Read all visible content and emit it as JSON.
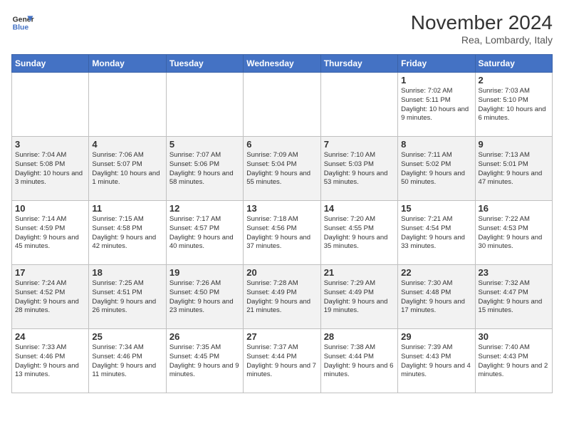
{
  "header": {
    "logo_line1": "General",
    "logo_line2": "Blue",
    "title": "November 2024",
    "subtitle": "Rea, Lombardy, Italy"
  },
  "days_of_week": [
    "Sunday",
    "Monday",
    "Tuesday",
    "Wednesday",
    "Thursday",
    "Friday",
    "Saturday"
  ],
  "weeks": [
    [
      {
        "day": "",
        "info": ""
      },
      {
        "day": "",
        "info": ""
      },
      {
        "day": "",
        "info": ""
      },
      {
        "day": "",
        "info": ""
      },
      {
        "day": "",
        "info": ""
      },
      {
        "day": "1",
        "info": "Sunrise: 7:02 AM\nSunset: 5:11 PM\nDaylight: 10 hours and 9 minutes."
      },
      {
        "day": "2",
        "info": "Sunrise: 7:03 AM\nSunset: 5:10 PM\nDaylight: 10 hours and 6 minutes."
      }
    ],
    [
      {
        "day": "3",
        "info": "Sunrise: 7:04 AM\nSunset: 5:08 PM\nDaylight: 10 hours and 3 minutes."
      },
      {
        "day": "4",
        "info": "Sunrise: 7:06 AM\nSunset: 5:07 PM\nDaylight: 10 hours and 1 minute."
      },
      {
        "day": "5",
        "info": "Sunrise: 7:07 AM\nSunset: 5:06 PM\nDaylight: 9 hours and 58 minutes."
      },
      {
        "day": "6",
        "info": "Sunrise: 7:09 AM\nSunset: 5:04 PM\nDaylight: 9 hours and 55 minutes."
      },
      {
        "day": "7",
        "info": "Sunrise: 7:10 AM\nSunset: 5:03 PM\nDaylight: 9 hours and 53 minutes."
      },
      {
        "day": "8",
        "info": "Sunrise: 7:11 AM\nSunset: 5:02 PM\nDaylight: 9 hours and 50 minutes."
      },
      {
        "day": "9",
        "info": "Sunrise: 7:13 AM\nSunset: 5:01 PM\nDaylight: 9 hours and 47 minutes."
      }
    ],
    [
      {
        "day": "10",
        "info": "Sunrise: 7:14 AM\nSunset: 4:59 PM\nDaylight: 9 hours and 45 minutes."
      },
      {
        "day": "11",
        "info": "Sunrise: 7:15 AM\nSunset: 4:58 PM\nDaylight: 9 hours and 42 minutes."
      },
      {
        "day": "12",
        "info": "Sunrise: 7:17 AM\nSunset: 4:57 PM\nDaylight: 9 hours and 40 minutes."
      },
      {
        "day": "13",
        "info": "Sunrise: 7:18 AM\nSunset: 4:56 PM\nDaylight: 9 hours and 37 minutes."
      },
      {
        "day": "14",
        "info": "Sunrise: 7:20 AM\nSunset: 4:55 PM\nDaylight: 9 hours and 35 minutes."
      },
      {
        "day": "15",
        "info": "Sunrise: 7:21 AM\nSunset: 4:54 PM\nDaylight: 9 hours and 33 minutes."
      },
      {
        "day": "16",
        "info": "Sunrise: 7:22 AM\nSunset: 4:53 PM\nDaylight: 9 hours and 30 minutes."
      }
    ],
    [
      {
        "day": "17",
        "info": "Sunrise: 7:24 AM\nSunset: 4:52 PM\nDaylight: 9 hours and 28 minutes."
      },
      {
        "day": "18",
        "info": "Sunrise: 7:25 AM\nSunset: 4:51 PM\nDaylight: 9 hours and 26 minutes."
      },
      {
        "day": "19",
        "info": "Sunrise: 7:26 AM\nSunset: 4:50 PM\nDaylight: 9 hours and 23 minutes."
      },
      {
        "day": "20",
        "info": "Sunrise: 7:28 AM\nSunset: 4:49 PM\nDaylight: 9 hours and 21 minutes."
      },
      {
        "day": "21",
        "info": "Sunrise: 7:29 AM\nSunset: 4:49 PM\nDaylight: 9 hours and 19 minutes."
      },
      {
        "day": "22",
        "info": "Sunrise: 7:30 AM\nSunset: 4:48 PM\nDaylight: 9 hours and 17 minutes."
      },
      {
        "day": "23",
        "info": "Sunrise: 7:32 AM\nSunset: 4:47 PM\nDaylight: 9 hours and 15 minutes."
      }
    ],
    [
      {
        "day": "24",
        "info": "Sunrise: 7:33 AM\nSunset: 4:46 PM\nDaylight: 9 hours and 13 minutes."
      },
      {
        "day": "25",
        "info": "Sunrise: 7:34 AM\nSunset: 4:46 PM\nDaylight: 9 hours and 11 minutes."
      },
      {
        "day": "26",
        "info": "Sunrise: 7:35 AM\nSunset: 4:45 PM\nDaylight: 9 hours and 9 minutes."
      },
      {
        "day": "27",
        "info": "Sunrise: 7:37 AM\nSunset: 4:44 PM\nDaylight: 9 hours and 7 minutes."
      },
      {
        "day": "28",
        "info": "Sunrise: 7:38 AM\nSunset: 4:44 PM\nDaylight: 9 hours and 6 minutes."
      },
      {
        "day": "29",
        "info": "Sunrise: 7:39 AM\nSunset: 4:43 PM\nDaylight: 9 hours and 4 minutes."
      },
      {
        "day": "30",
        "info": "Sunrise: 7:40 AM\nSunset: 4:43 PM\nDaylight: 9 hours and 2 minutes."
      }
    ]
  ]
}
